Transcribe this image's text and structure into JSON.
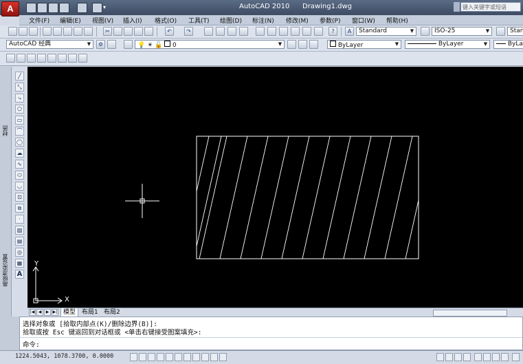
{
  "title_bar": {
    "app_name": "AutoCAD 2010",
    "document_name": "Drawing1.dwg",
    "search_placeholder": "键入关键字或短语"
  },
  "menu": {
    "items": [
      "文件(F)",
      "编辑(E)",
      "视图(V)",
      "插入(I)",
      "格式(O)",
      "工具(T)",
      "绘图(D)",
      "标注(N)",
      "修改(M)",
      "参数(P)",
      "窗口(W)",
      "帮助(H)"
    ]
  },
  "styles_toolbar": {
    "text_style": "Standard",
    "dim_style": "ISO-25",
    "table_style": "Stan"
  },
  "layers_toolbar": {
    "workspace": "AutoCAD 经典",
    "current_layer": "0",
    "color": "ByLayer",
    "linetype": "ByLayer",
    "lineweight": "ByLa"
  },
  "left_palette": {
    "label_top": "材质",
    "label_bottom": "高级渲染设置"
  },
  "canvas": {
    "ucs_x": "X",
    "ucs_y": "Y"
  },
  "layout_tabs": {
    "tabs": [
      "模型",
      "布局1",
      "布局2"
    ],
    "active": "模型"
  },
  "command": {
    "line1": "选择对象或 [拾取内部点(K)/删除边界(B)]:",
    "line2": "拾取或按 Esc 键返回到对话框或 <单击右键接受图案填充>:",
    "prompt": "命令:"
  },
  "status": {
    "coordinates": "1224.5043, 1078.3700, 0.0000"
  },
  "colors": {
    "canvas_bg": "#000000",
    "drawing_lines": "#ffffff",
    "title_bar": "#4a5a72"
  }
}
